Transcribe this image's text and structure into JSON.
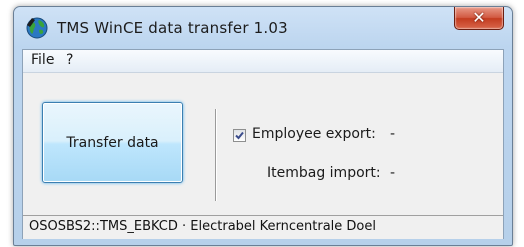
{
  "window": {
    "title": "TMS WinCE data transfer 1.03",
    "close_glyph": "✕"
  },
  "menu": {
    "items": [
      "File",
      "?"
    ]
  },
  "actions": {
    "transfer_label": "Transfer data"
  },
  "exports": {
    "employee": {
      "label": "Employee export:",
      "value": "-",
      "checked": true
    },
    "itembag": {
      "label": "Itembag import:",
      "value": "-"
    }
  },
  "statusbar": {
    "text": "OSOSBS2::TMS_EBKCD · Electrabel Kerncentrale Doel"
  },
  "icons": {
    "app": "globe-icon",
    "close": "close-icon",
    "checkmark": "checkmark-icon"
  },
  "colors": {
    "accent": "#3c7fb1",
    "close": "#c33b20"
  }
}
